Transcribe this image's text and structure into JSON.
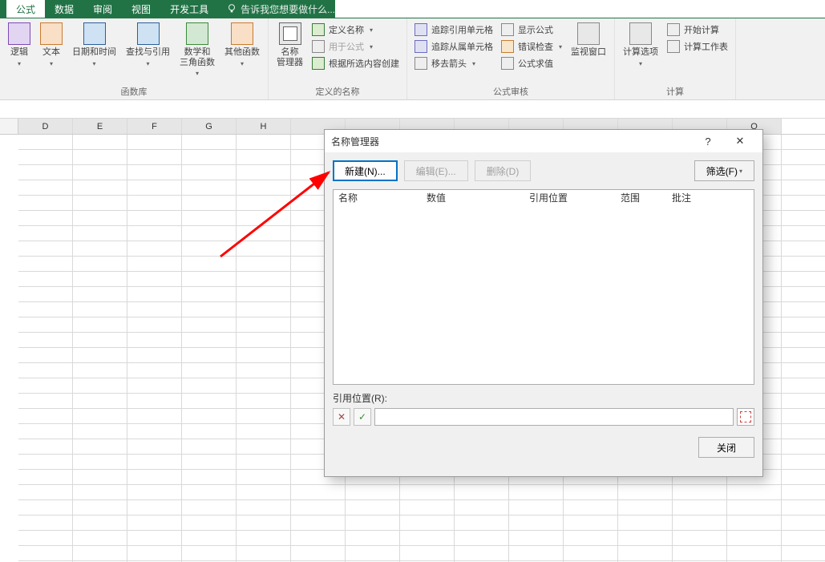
{
  "tabs": {
    "t1": "公式",
    "t2": "数据",
    "t3": "审阅",
    "t4": "视图",
    "t5": "开发工具",
    "tellme": "告诉我您想要做什么..."
  },
  "ribbon": {
    "library_label": "函数库",
    "logic": "逻辑",
    "text": "文本",
    "datetime": "日期和时间",
    "lookup": "查找与引用",
    "mathtrig": "数学和\n三角函数",
    "more": "其他函数",
    "defined_label": "定义的名称",
    "name_mgr": "名称\n管理器",
    "def_define": "定义名称",
    "def_use": "用于公式",
    "def_create": "根据所选内容创建",
    "audit_label": "公式审核",
    "aud_precedents": "追踪引用单元格",
    "aud_dependents": "追踪从属单元格",
    "aud_remove": "移去箭头",
    "aud_showf": "显示公式",
    "aud_err": "错误检查",
    "aud_eval": "公式求值",
    "watch": "监视窗口",
    "calc_label": "计算",
    "calc_opt": "计算选项",
    "calc_now": "开始计算",
    "calc_sheet": "计算工作表"
  },
  "columns": [
    "D",
    "E",
    "F",
    "G",
    "H",
    "",
    "",
    "",
    "",
    "",
    "",
    "",
    "",
    "Q"
  ],
  "dialog": {
    "title": "名称管理器",
    "help": "?",
    "close_x": "✕",
    "new_btn": "新建(N)...",
    "edit_btn": "编辑(E)...",
    "del_btn": "删除(D)",
    "filter_btn": "筛选(F)",
    "col_name": "名称",
    "col_value": "数值",
    "col_ref": "引用位置",
    "col_scope": "范围",
    "col_comment": "批注",
    "ref_label": "引用位置(R):",
    "tgl_x": "✕",
    "tgl_v": "✓",
    "close_btn": "关闭"
  }
}
